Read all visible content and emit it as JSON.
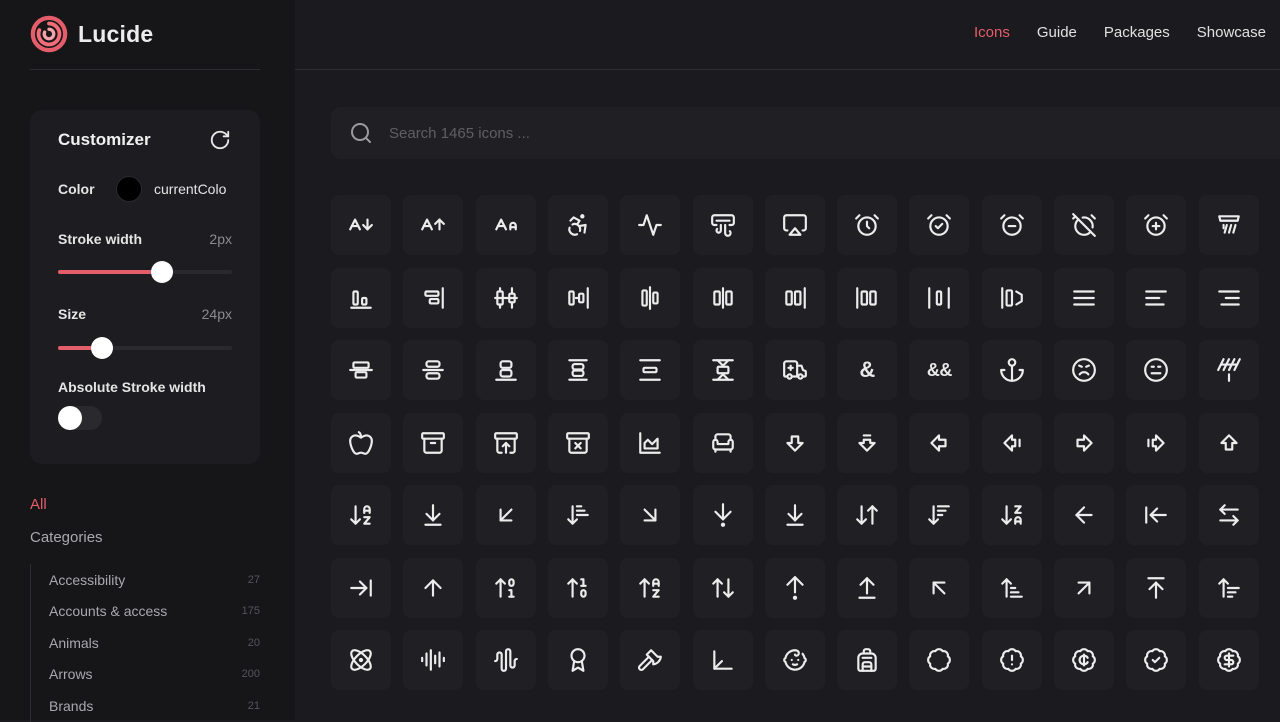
{
  "brand": {
    "name": "Lucide",
    "accent": "#e35d6a"
  },
  "nav": [
    {
      "label": "Icons",
      "active": true
    },
    {
      "label": "Guide",
      "active": false
    },
    {
      "label": "Packages",
      "active": false
    },
    {
      "label": "Showcase",
      "active": false
    }
  ],
  "customizer": {
    "title": "Customizer",
    "reset_icon": "rotate-cw-icon",
    "color": {
      "label": "Color",
      "value": "currentColor",
      "swatch": "#000000"
    },
    "stroke_width": {
      "label": "Stroke width",
      "value": "2px",
      "fraction": 0.6
    },
    "size": {
      "label": "Size",
      "value": "24px",
      "fraction": 0.25
    },
    "absolute_stroke": {
      "label": "Absolute Stroke width",
      "enabled": false
    }
  },
  "filters": {
    "all": "All",
    "categories_heading": "Categories",
    "categories": [
      {
        "name": "Accessibility",
        "count": "27"
      },
      {
        "name": "Accounts & access",
        "count": "175"
      },
      {
        "name": "Animals",
        "count": "20"
      },
      {
        "name": "Arrows",
        "count": "200"
      },
      {
        "name": "Brands",
        "count": "21"
      }
    ]
  },
  "search": {
    "placeholder": "Search 1465 icons ..."
  },
  "icons": [
    [
      "a-arrow-down",
      "a-arrow-up",
      "a-large-small",
      "accessibility",
      "activity",
      "air-vent",
      "airplay",
      "alarm-clock",
      "alarm-clock-check",
      "alarm-clock-minus",
      "alarm-clock-off",
      "alarm-clock-plus",
      "alarm-smoke"
    ],
    [
      "align-bottom-justify",
      "align-end-horizontal",
      "align-center-horizontal",
      "align-end-vertical",
      "align-center-vertical",
      "align-horizontal-distribute",
      "align-horizontal-space-around",
      "align-start-vertical",
      "align-horizontal-space-between",
      "align-horizontal-justify-end",
      "align-justify",
      "align-left",
      "align-right"
    ],
    [
      "align-vertical-distribute",
      "align-center",
      "align-bottom",
      "align-vertical-space-around",
      "align-vertical-space-between",
      "align-vertical-justify",
      "ambulance",
      "ampersand",
      "ampersands",
      "anchor",
      "angry",
      "annoyed",
      "antenna"
    ],
    [
      "apple",
      "archive",
      "archive-restore",
      "archive-x",
      "area-chart",
      "armchair",
      "arrow-big-down",
      "arrow-big-down-dash",
      "arrow-big-left",
      "arrow-big-left-dash",
      "arrow-big-right",
      "arrow-big-right-dash",
      "arrow-big-up"
    ],
    [
      "arrow-down-a-z",
      "arrow-down-to-line",
      "arrow-down-left",
      "arrow-down-narrow-wide",
      "arrow-down-right",
      "arrow-down-to-dot",
      "arrow-down-to-line-2",
      "arrow-down-up",
      "arrow-down-wide-narrow",
      "arrow-down-z-a",
      "arrow-left",
      "arrow-left-to-line",
      "arrow-left-right"
    ],
    [
      "arrow-right-to-line",
      "arrow-up",
      "arrow-up-0-1",
      "arrow-up-1-0",
      "arrow-up-a-z",
      "arrow-up-down",
      "arrow-up-from-dot",
      "arrow-up-from-line",
      "arrow-up-left",
      "arrow-up-narrow-wide",
      "arrow-up-right",
      "arrow-up-to-line",
      "arrow-up-wide-narrow"
    ],
    [
      "atom",
      "audio-lines",
      "audio-waveform",
      "award",
      "axe",
      "axis-3d",
      "baby",
      "backpack",
      "badge",
      "badge-alert",
      "badge-cent",
      "badge-check",
      "badge-dollar-sign"
    ]
  ]
}
